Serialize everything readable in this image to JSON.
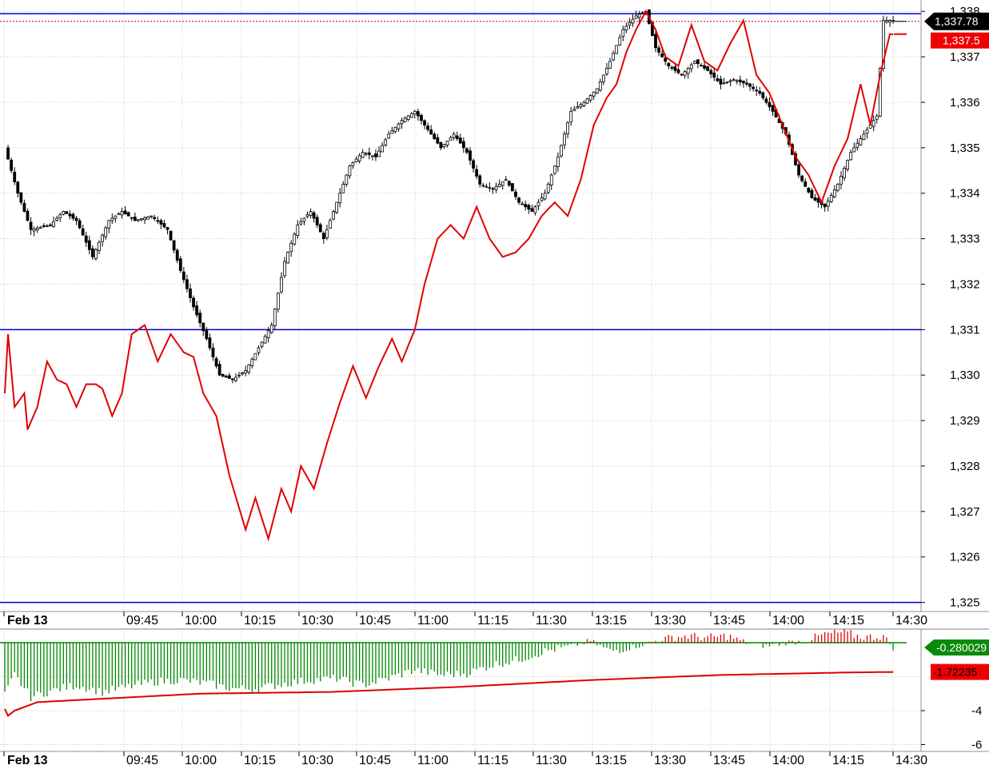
{
  "chart_data": [
    {
      "type": "candlestick",
      "x_labels": [
        "Feb 13",
        "09:45",
        "10:00",
        "10:15",
        "10:30",
        "10:45",
        "11:00",
        "11:15",
        "11:30",
        "13:15",
        "13:30",
        "13:45",
        "14:00",
        "14:15",
        "14:30"
      ],
      "y_ticks": [
        "1,325",
        "1,326",
        "1,327",
        "1,328",
        "1,329",
        "1,330",
        "1,331",
        "1,332",
        "1,333",
        "1,334",
        "1,335",
        "1,336",
        "1,337",
        "1,338"
      ],
      "ylim": [
        1324.8,
        1338.25
      ],
      "horizontal_lines": [
        1337.95,
        1331.0,
        1325.0
      ],
      "last_price_line": 1337.78,
      "price_label": "1,337.78",
      "overlay_label": "1,337.5",
      "price_series_anchors": [
        [
          0,
          1335.0
        ],
        [
          4,
          1334.0
        ],
        [
          8,
          1333.2
        ],
        [
          14,
          1333.3
        ],
        [
          18,
          1333.6
        ],
        [
          22,
          1333.4
        ],
        [
          27,
          1332.6
        ],
        [
          32,
          1333.4
        ],
        [
          36,
          1333.6
        ],
        [
          40,
          1333.4
        ],
        [
          45,
          1333.5
        ],
        [
          50,
          1333.2
        ],
        [
          54,
          1332.3
        ],
        [
          58,
          1331.5
        ],
        [
          62,
          1330.8
        ],
        [
          66,
          1330.0
        ],
        [
          70,
          1329.9
        ],
        [
          74,
          1330.1
        ],
        [
          78,
          1330.6
        ],
        [
          82,
          1331.1
        ],
        [
          86,
          1332.5
        ],
        [
          90,
          1333.3
        ],
        [
          94,
          1333.6
        ],
        [
          98,
          1333.0
        ],
        [
          102,
          1333.8
        ],
        [
          106,
          1334.6
        ],
        [
          110,
          1334.9
        ],
        [
          114,
          1334.8
        ],
        [
          118,
          1335.3
        ],
        [
          122,
          1335.6
        ],
        [
          126,
          1335.8
        ],
        [
          130,
          1335.4
        ],
        [
          134,
          1335.0
        ],
        [
          138,
          1335.3
        ],
        [
          142,
          1334.9
        ],
        [
          146,
          1334.2
        ],
        [
          150,
          1334.1
        ],
        [
          154,
          1334.3
        ],
        [
          158,
          1333.8
        ],
        [
          162,
          1333.6
        ],
        [
          166,
          1334.0
        ],
        [
          170,
          1334.8
        ],
        [
          174,
          1335.8
        ],
        [
          178,
          1336.0
        ],
        [
          182,
          1336.3
        ],
        [
          186,
          1336.9
        ],
        [
          190,
          1337.6
        ],
        [
          194,
          1337.9
        ],
        [
          197,
          1338.0
        ],
        [
          200,
          1337.2
        ],
        [
          204,
          1336.8
        ],
        [
          208,
          1336.6
        ],
        [
          212,
          1336.9
        ],
        [
          216,
          1336.7
        ],
        [
          220,
          1336.4
        ],
        [
          224,
          1336.5
        ],
        [
          228,
          1336.4
        ],
        [
          232,
          1336.2
        ],
        [
          236,
          1335.8
        ],
        [
          240,
          1335.3
        ],
        [
          244,
          1334.4
        ],
        [
          248,
          1333.9
        ],
        [
          252,
          1333.7
        ],
        [
          256,
          1334.2
        ],
        [
          260,
          1334.9
        ],
        [
          264,
          1335.3
        ],
        [
          268,
          1335.7
        ],
        [
          270,
          1337.8
        ]
      ],
      "overlay_series": {
        "name": "",
        "anchors": [
          [
            0,
            1329.6
          ],
          [
            1,
            1330.9
          ],
          [
            3,
            1329.3
          ],
          [
            6,
            1329.6
          ],
          [
            7,
            1328.8
          ],
          [
            10,
            1329.3
          ],
          [
            13,
            1330.3
          ],
          [
            16,
            1329.9
          ],
          [
            19,
            1329.8
          ],
          [
            22,
            1329.3
          ],
          [
            25,
            1329.8
          ],
          [
            28,
            1329.8
          ],
          [
            30,
            1329.7
          ],
          [
            33,
            1329.1
          ],
          [
            36,
            1329.6
          ],
          [
            39,
            1330.9
          ],
          [
            43,
            1331.1
          ],
          [
            47,
            1330.3
          ],
          [
            51,
            1330.9
          ],
          [
            55,
            1330.5
          ],
          [
            58,
            1330.4
          ],
          [
            61,
            1329.6
          ],
          [
            65,
            1329.1
          ],
          [
            69,
            1327.8
          ],
          [
            74,
            1326.6
          ],
          [
            77,
            1327.3
          ],
          [
            81,
            1326.4
          ],
          [
            85,
            1327.5
          ],
          [
            88,
            1327.0
          ],
          [
            91,
            1328.0
          ],
          [
            95,
            1327.5
          ],
          [
            99,
            1328.5
          ],
          [
            103,
            1329.4
          ],
          [
            107,
            1330.2
          ],
          [
            111,
            1329.5
          ],
          [
            115,
            1330.2
          ],
          [
            119,
            1330.8
          ],
          [
            122,
            1330.3
          ],
          [
            126,
            1331.0
          ],
          [
            129,
            1332.0
          ],
          [
            133,
            1333.0
          ],
          [
            137,
            1333.3
          ],
          [
            141,
            1333.0
          ],
          [
            145,
            1333.7
          ],
          [
            149,
            1333.0
          ],
          [
            153,
            1332.6
          ],
          [
            157,
            1332.7
          ],
          [
            161,
            1333.0
          ],
          [
            165,
            1333.5
          ],
          [
            169,
            1333.8
          ],
          [
            173,
            1333.5
          ],
          [
            177,
            1334.3
          ],
          [
            181,
            1335.5
          ],
          [
            185,
            1336.1
          ],
          [
            188,
            1336.4
          ],
          [
            191,
            1337.1
          ],
          [
            194,
            1337.6
          ],
          [
            197,
            1338.0
          ],
          [
            200,
            1337.6
          ],
          [
            203,
            1337.0
          ],
          [
            207,
            1336.8
          ],
          [
            211,
            1337.7
          ],
          [
            215,
            1336.9
          ],
          [
            219,
            1336.7
          ],
          [
            223,
            1337.3
          ],
          [
            227,
            1337.8
          ],
          [
            231,
            1336.6
          ],
          [
            235,
            1336.2
          ],
          [
            239,
            1335.5
          ],
          [
            243,
            1334.8
          ],
          [
            247,
            1334.4
          ],
          [
            251,
            1333.8
          ],
          [
            255,
            1334.6
          ],
          [
            259,
            1335.2
          ],
          [
            263,
            1336.4
          ],
          [
            266,
            1335.5
          ],
          [
            269,
            1336.6
          ],
          [
            272,
            1337.5
          ]
        ]
      }
    },
    {
      "type": "bar",
      "x_labels": [
        "Feb 13",
        "09:45",
        "10:00",
        "10:15",
        "10:30",
        "10:45",
        "11:00",
        "11:15",
        "11:30",
        "13:15",
        "13:30",
        "13:45",
        "14:00",
        "14:15",
        "14:30"
      ],
      "y_ticks": [
        "-4",
        "-6"
      ],
      "ylim": [
        -6.4,
        0.8
      ],
      "histogram_anchors": [
        [
          0,
          -3.1
        ],
        [
          3,
          -1.9
        ],
        [
          8,
          -3.2
        ],
        [
          15,
          -2.8
        ],
        [
          22,
          -2.5
        ],
        [
          30,
          -2.9
        ],
        [
          38,
          -2.6
        ],
        [
          46,
          -2.3
        ],
        [
          54,
          -2.2
        ],
        [
          62,
          -2.4
        ],
        [
          70,
          -2.7
        ],
        [
          78,
          -2.7
        ],
        [
          86,
          -2.4
        ],
        [
          94,
          -2.2
        ],
        [
          102,
          -2.1
        ],
        [
          110,
          -2.5
        ],
        [
          118,
          -2.1
        ],
        [
          126,
          -1.6
        ],
        [
          134,
          -1.9
        ],
        [
          142,
          -1.8
        ],
        [
          150,
          -1.3
        ],
        [
          158,
          -1.0
        ],
        [
          166,
          -0.5
        ],
        [
          174,
          -0.2
        ],
        [
          180,
          0.1
        ],
        [
          186,
          -0.5
        ],
        [
          192,
          -0.3
        ],
        [
          198,
          0.0
        ],
        [
          204,
          0.3
        ],
        [
          210,
          0.4
        ],
        [
          216,
          0.3
        ],
        [
          222,
          0.4
        ],
        [
          228,
          0.0
        ],
        [
          234,
          -0.2
        ],
        [
          240,
          0.0
        ],
        [
          246,
          0.1
        ],
        [
          252,
          0.5
        ],
        [
          258,
          0.6
        ],
        [
          264,
          0.3
        ],
        [
          270,
          0.4
        ],
        [
          273,
          -0.28
        ]
      ],
      "histogram_label": "-0.280029",
      "signal_label": "-1.72235",
      "signal_line": [
        [
          0,
          -3.9
        ],
        [
          1,
          -4.3
        ],
        [
          3,
          -4.0
        ],
        [
          10,
          -3.5
        ],
        [
          30,
          -3.3
        ],
        [
          60,
          -3.0
        ],
        [
          100,
          -2.9
        ],
        [
          140,
          -2.6
        ],
        [
          180,
          -2.2
        ],
        [
          220,
          -1.9
        ],
        [
          260,
          -1.75
        ],
        [
          275,
          -1.72
        ]
      ],
      "colors": {
        "positive": "#dd0000",
        "negative": "#008800",
        "signal": "#dd0000"
      }
    }
  ],
  "colors": {
    "up_candle": "#ffffff",
    "down_candle": "#000000",
    "overlay": "#e00000",
    "levels": "#0000cc",
    "grid": "#c8c8c8"
  }
}
